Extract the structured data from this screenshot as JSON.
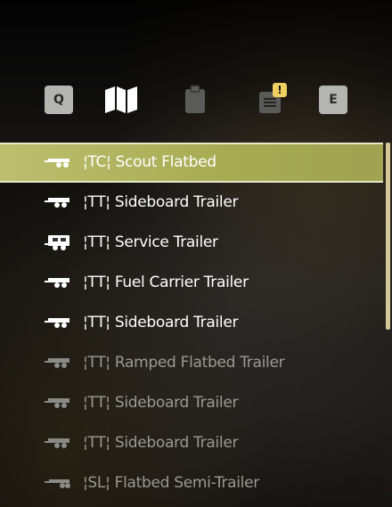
{
  "toolbar": {
    "left_key": "Q",
    "right_key": "E",
    "tabs": [
      {
        "name": "map-icon",
        "active": true
      },
      {
        "name": "clipboard-icon",
        "active": false
      },
      {
        "name": "list-icon",
        "active": false,
        "badge": "!"
      }
    ],
    "badge_color": "#f0d060"
  },
  "list": {
    "selected_color": "#b4b868",
    "items": [
      {
        "label": "¦TC¦ Scout Flatbed",
        "icon": "flatbed-trailer-icon",
        "state": "selected"
      },
      {
        "label": "¦TT¦ Sideboard Trailer",
        "icon": "trailer-icon",
        "state": "active"
      },
      {
        "label": "¦TT¦ Service Trailer",
        "icon": "service-trailer-icon",
        "state": "active"
      },
      {
        "label": "¦TT¦ Fuel Carrier Trailer",
        "icon": "trailer-icon",
        "state": "active"
      },
      {
        "label": "¦TT¦ Sideboard Trailer",
        "icon": "trailer-icon",
        "state": "active"
      },
      {
        "label": "¦TT¦ Ramped Flatbed Trailer",
        "icon": "trailer-icon",
        "state": "dim"
      },
      {
        "label": "¦TT¦ Sideboard Trailer",
        "icon": "trailer-icon",
        "state": "dim"
      },
      {
        "label": "¦TT¦ Sideboard Trailer",
        "icon": "trailer-icon",
        "state": "dim"
      },
      {
        "label": "¦SL¦ Flatbed Semi-Trailer",
        "icon": "semi-trailer-icon",
        "state": "dim"
      }
    ]
  }
}
